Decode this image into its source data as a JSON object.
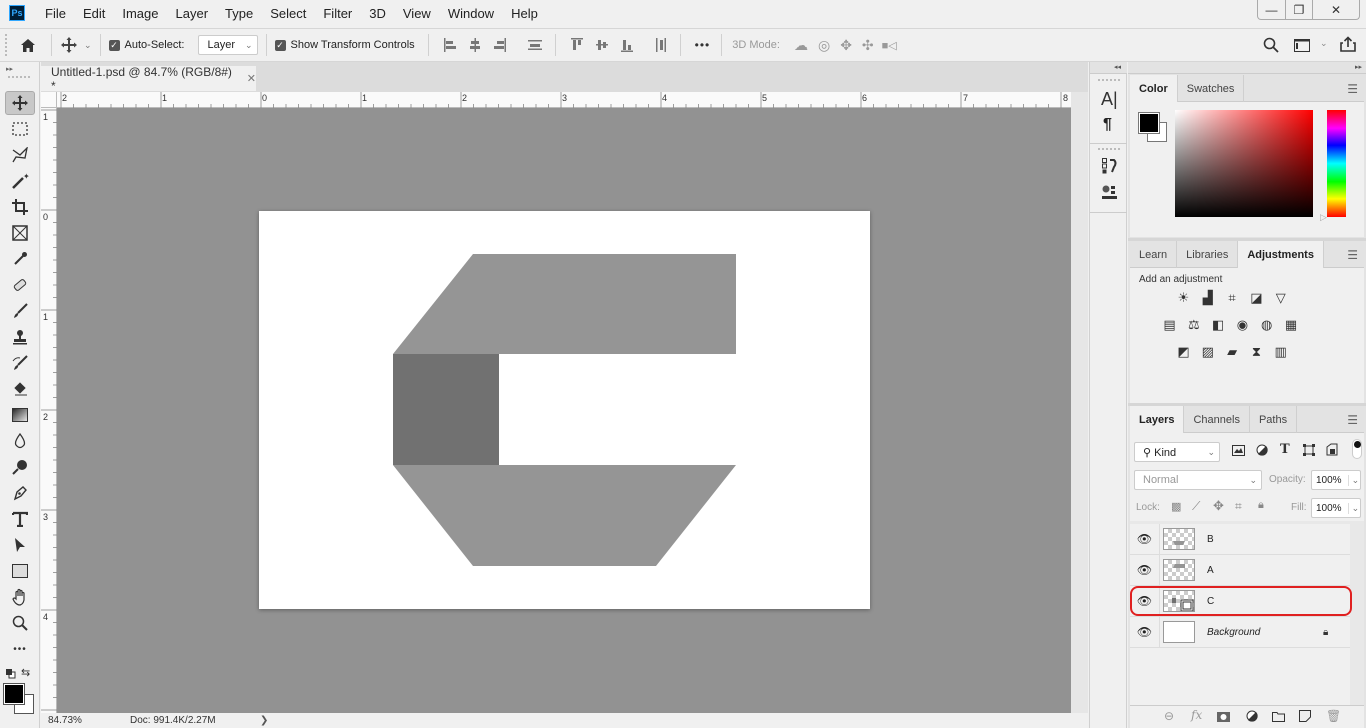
{
  "app": {
    "logo": "Ps"
  },
  "menu": [
    "File",
    "Edit",
    "Image",
    "Layer",
    "Type",
    "Select",
    "Filter",
    "3D",
    "View",
    "Window",
    "Help"
  ],
  "window_controls": {
    "minimize": "—",
    "restore": "❐",
    "close": "✕"
  },
  "options_bar": {
    "auto_select_label": "Auto-Select:",
    "auto_select_checked": true,
    "auto_select_target": "Layer",
    "show_transform_label": "Show Transform Controls",
    "show_transform_checked": true,
    "more_label": "•••",
    "mode_3d_label": "3D Mode:"
  },
  "document": {
    "tab_title": "Untitled-1.psd @ 84.7% (RGB/8#) *",
    "close_icon": "✕",
    "h_ruler_labels": [
      "2",
      "1",
      "0",
      "1",
      "2",
      "3",
      "4",
      "5",
      "6",
      "7",
      "8"
    ],
    "v_ruler_labels": [
      "1",
      "0",
      "1",
      "2",
      "3",
      "4"
    ],
    "canvas_colors": {
      "background": "#ffffff",
      "shape_light": "#959595",
      "shape_dark": "#717171",
      "pasteboard": "#929292"
    }
  },
  "status_bar": {
    "zoom": "84.73%",
    "doc_info": "Doc: 991.4K/2.27M",
    "arrow": "❯"
  },
  "color_panel": {
    "tabs": [
      "Color",
      "Swatches"
    ],
    "active_tab": "Color",
    "foreground": "#000000",
    "background": "#ffffff",
    "hue_color": "#ff0000"
  },
  "adjustments_panel": {
    "tabs": [
      "Learn",
      "Libraries",
      "Adjustments"
    ],
    "active_tab": "Adjustments",
    "heading": "Add an adjustment",
    "rows": [
      [
        "brightness-contrast",
        "levels",
        "curves",
        "exposure",
        "vibrance"
      ],
      [
        "hue-saturation",
        "color-balance",
        "black-white",
        "photo-filter",
        "channel-mixer",
        "color-lookup"
      ],
      [
        "invert",
        "posterize",
        "threshold",
        "selective-color",
        "gradient-map"
      ]
    ]
  },
  "layers_panel": {
    "tabs": [
      "Layers",
      "Channels",
      "Paths"
    ],
    "active_tab": "Layers",
    "filter_kind": "Kind",
    "blend_mode": "Normal",
    "opacity_label": "Opacity:",
    "opacity": "100%",
    "lock_label": "Lock:",
    "fill_label": "Fill:",
    "fill": "100%",
    "layers": [
      {
        "name": "B",
        "visible": true,
        "selected": false,
        "locked": false
      },
      {
        "name": "A",
        "visible": true,
        "selected": false,
        "locked": false
      },
      {
        "name": "C",
        "visible": true,
        "selected": true,
        "locked": false
      },
      {
        "name": "Background",
        "visible": true,
        "selected": false,
        "locked": true
      }
    ],
    "highlight_color": "#e02020"
  }
}
